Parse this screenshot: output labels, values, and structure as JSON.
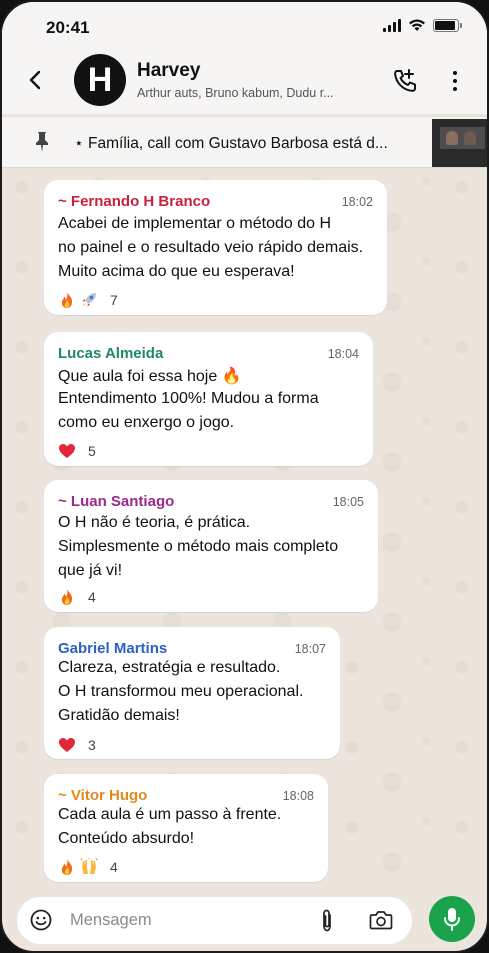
{
  "status_bar": {
    "time": "20:41",
    "battery_level": 0.9
  },
  "header": {
    "avatar_letter": "H",
    "title": "Harvey",
    "subtitle": "Arthur auts, Bruno kabum, Dudu r..."
  },
  "pinned": {
    "text": "⋆ Família, call com Gustavo Barbosa está d..."
  },
  "messages": [
    {
      "sender": "~ Fernando H Branco",
      "sender_color": "#c8213f",
      "time": "18:02",
      "lines": [
        "Acabei de implementar o método do H",
        "no painel e o resultado veio rápido demais.",
        "Muito acima do que eu esperava!"
      ],
      "reactions": [
        "fire",
        "rocket"
      ],
      "reaction_count": "7"
    },
    {
      "sender": "Lucas Almeida",
      "sender_color": "#1f8a5c",
      "time": "18:04",
      "lines": [
        "Que aula foi essa hoje 🔥",
        "Entendimento 100%! Mudou a forma",
        "como eu enxergo o jogo."
      ],
      "reactions": [
        "heart"
      ],
      "reaction_count": "5"
    },
    {
      "sender": "~ Luan Santiago",
      "sender_color": "#9b2a8a",
      "time": "18:05",
      "lines": [
        "O H não é teoria, é prática.",
        "Simplesmente o método mais completo",
        "que já vi!"
      ],
      "reactions": [
        "fire"
      ],
      "reaction_count": "4"
    },
    {
      "sender": "Gabriel Martins",
      "sender_color": "#2e5fc4",
      "time": "18:07",
      "lines": [
        "Clareza, estratégia e resultado.",
        "O H transformou meu operacional.",
        "Gratidão demais!"
      ],
      "reactions": [
        "heart"
      ],
      "reaction_count": "3"
    },
    {
      "sender": "~ Vitor Hugo",
      "sender_color": "#e08a1e",
      "time": "18:08",
      "lines": [
        "Cada aula é um passo à frente.",
        "Conteúdo absurdo!"
      ],
      "reactions": [
        "fire",
        "raised-hands"
      ],
      "reaction_count": "4"
    }
  ],
  "input": {
    "placeholder": "Mensagem"
  }
}
